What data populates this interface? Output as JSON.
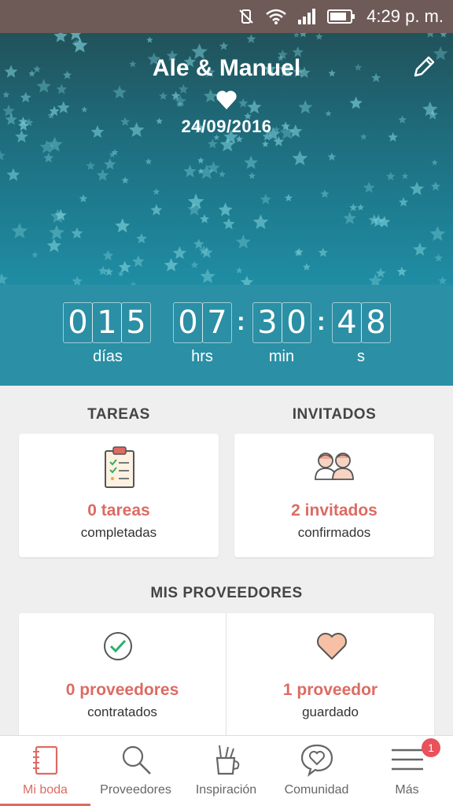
{
  "status_bar": {
    "time": "4:29 p. m."
  },
  "hero": {
    "couple_names": "Ale & Manuel",
    "date": "24/09/2016"
  },
  "countdown": {
    "days": [
      "0",
      "1",
      "5"
    ],
    "hours": [
      "0",
      "7"
    ],
    "minutes": [
      "3",
      "0"
    ],
    "seconds": [
      "4",
      "8"
    ],
    "separator": ":",
    "labels": {
      "days": "días",
      "hours": "hrs",
      "minutes": "min",
      "seconds": "s"
    }
  },
  "tasks": {
    "title": "TAREAS",
    "count": "0 tareas",
    "subtitle": "completadas"
  },
  "guests": {
    "title": "INVITADOS",
    "count": "2 invitados",
    "subtitle": "confirmados"
  },
  "vendors": {
    "title": "MIS PROVEEDORES",
    "hired": {
      "count": "0 proveedores",
      "subtitle": "contratados"
    },
    "saved": {
      "count": "1 proveedor",
      "subtitle": "guardado"
    }
  },
  "bottom_nav": {
    "items": [
      {
        "label": "Mi boda",
        "icon": "notebook-icon",
        "active": true
      },
      {
        "label": "Proveedores",
        "icon": "search-icon"
      },
      {
        "label": "Inspiración",
        "icon": "pencil-cup-icon"
      },
      {
        "label": "Comunidad",
        "icon": "chat-heart-icon"
      },
      {
        "label": "Más",
        "icon": "menu-icon"
      }
    ],
    "badge": "1"
  },
  "colors": {
    "accent": "#dd6b63",
    "teal": "#2b8fa5",
    "status_bar": "#6e5a57"
  }
}
